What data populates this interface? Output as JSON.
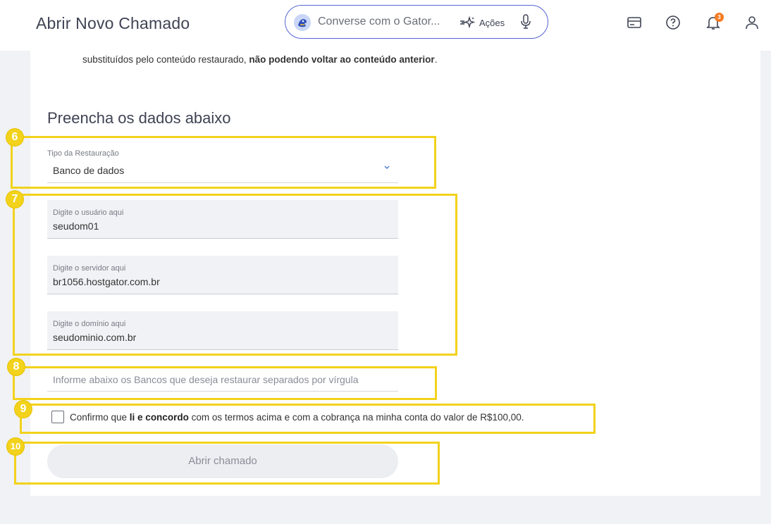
{
  "header": {
    "title": "Abrir Novo Chamado",
    "chat_placeholder": "Converse com o Gator...",
    "actions_label": "Ações",
    "notification_count": "3"
  },
  "notice": {
    "text_before": "substituídos pelo conteúdo restaurado, ",
    "text_bold": "não podendo voltar ao conteúdo anterior",
    "text_after": "."
  },
  "form": {
    "section_title": "Preencha os dados abaixo",
    "restore_type": {
      "label": "Tipo da Restauração",
      "value": "Banco de dados"
    },
    "user": {
      "label": "Digite o usuário aqui",
      "value": "seudom01"
    },
    "server": {
      "label": "Digite o servidor aqui",
      "value": "br1056.hostgator.com.br"
    },
    "domain": {
      "label": "Digite o domínio aqui",
      "value": "seudominio.com.br"
    },
    "databases_placeholder": "Informe abaixo os Bancos que deseja restaurar separados por vírgula",
    "confirm": {
      "before": "Confirmo que ",
      "bold": "li e concordo",
      "after": " com os termos acima e com a cobrança na minha conta do valor de R$100,00.",
      "checked": false
    },
    "submit_label": "Abrir chamado"
  },
  "annotations": [
    "6",
    "7",
    "8",
    "9",
    "10"
  ],
  "colors": {
    "highlight": "#f2d21b",
    "accent": "#5566d6",
    "badge": "#f47b22"
  }
}
